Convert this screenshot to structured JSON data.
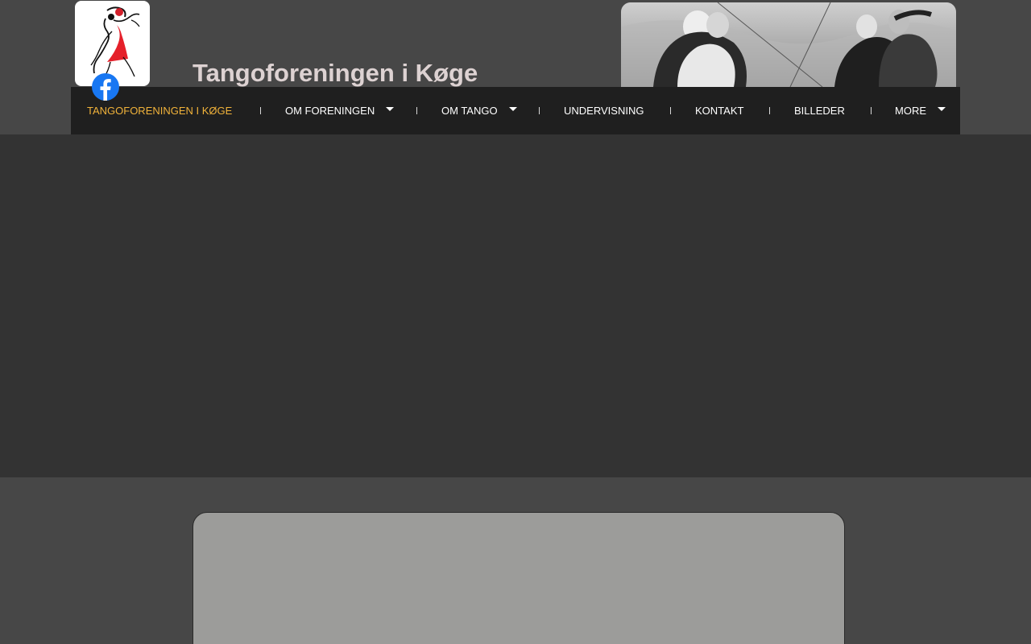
{
  "site": {
    "title": "Tangoforeningen i Køge"
  },
  "nav": {
    "items": [
      {
        "label": "TANGOFORENINGEN I KØGE",
        "active": true,
        "dropdown": false
      },
      {
        "label": "OM FORENINGEN",
        "active": false,
        "dropdown": true
      },
      {
        "label": "OM TANGO",
        "active": false,
        "dropdown": true
      },
      {
        "label": "UNDERVISNING",
        "active": false,
        "dropdown": false
      },
      {
        "label": "KONTAKT",
        "active": false,
        "dropdown": false
      },
      {
        "label": "BILLEDER",
        "active": false,
        "dropdown": false
      },
      {
        "label": "MORE",
        "active": false,
        "dropdown": true
      }
    ]
  },
  "icons": {
    "logo": "dancers-logo",
    "social": "facebook-icon",
    "banner": "dancing-couples-photo"
  },
  "colors": {
    "page_bg": "#474747",
    "nav_bg": "#1f1f1f",
    "nav_active": "#f0b23a",
    "nav_text": "#ffffff",
    "title_text": "#ddd2d2",
    "hero_bg": "#333333",
    "content_bg": "#9c9c9a",
    "facebook_blue": "#1877f2"
  }
}
